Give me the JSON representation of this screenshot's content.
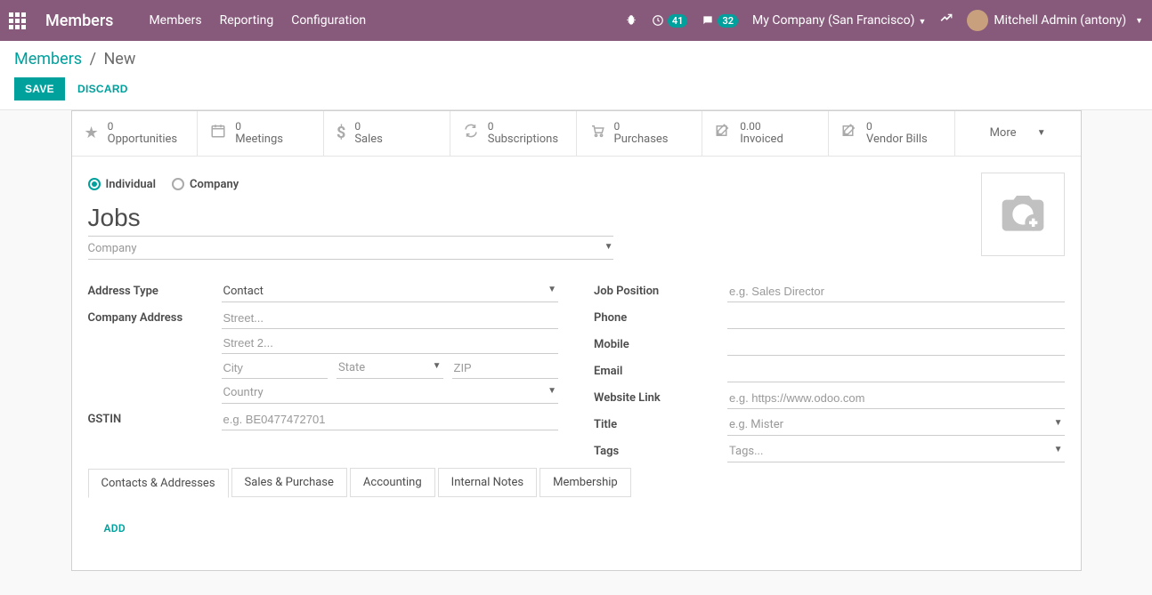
{
  "nav": {
    "brand": "Members",
    "links": [
      "Members",
      "Reporting",
      "Configuration"
    ],
    "badge1": "41",
    "badge2": "32",
    "company": "My Company (San Francisco)",
    "user": "Mitchell Admin (antony)"
  },
  "breadcrumb": {
    "root": "Members",
    "current": "New"
  },
  "actions": {
    "save": "SAVE",
    "discard": "DISCARD"
  },
  "stats": {
    "opportunities": {
      "val": "0",
      "label": "Opportunities"
    },
    "meetings": {
      "val": "0",
      "label": "Meetings"
    },
    "sales": {
      "val": "0",
      "label": "Sales"
    },
    "subscriptions": {
      "val": "0",
      "label": "Subscriptions"
    },
    "purchases": {
      "val": "0",
      "label": "Purchases"
    },
    "invoiced": {
      "val": "0.00",
      "label": "Invoiced"
    },
    "vendor_bills": {
      "val": "0",
      "label": "Vendor Bills"
    },
    "more": "More"
  },
  "radio": {
    "individual": "Individual",
    "company": "Company"
  },
  "name": "Jobs",
  "company_placeholder": "Company",
  "left": {
    "address_type_label": "Address Type",
    "address_type_value": "Contact",
    "company_address_label": "Company Address",
    "street_ph": "Street...",
    "street2_ph": "Street 2...",
    "city_ph": "City",
    "state_ph": "State",
    "zip_ph": "ZIP",
    "country_ph": "Country",
    "gstin_label": "GSTIN",
    "gstin_ph": "e.g. BE0477472701"
  },
  "right": {
    "job_position_label": "Job Position",
    "job_position_ph": "e.g. Sales Director",
    "phone_label": "Phone",
    "mobile_label": "Mobile",
    "email_label": "Email",
    "website_label": "Website Link",
    "website_ph": "e.g. https://www.odoo.com",
    "title_label": "Title",
    "title_ph": "e.g. Mister",
    "tags_label": "Tags",
    "tags_ph": "Tags..."
  },
  "tabs": [
    "Contacts & Addresses",
    "Sales & Purchase",
    "Accounting",
    "Internal Notes",
    "Membership"
  ],
  "add": "ADD"
}
